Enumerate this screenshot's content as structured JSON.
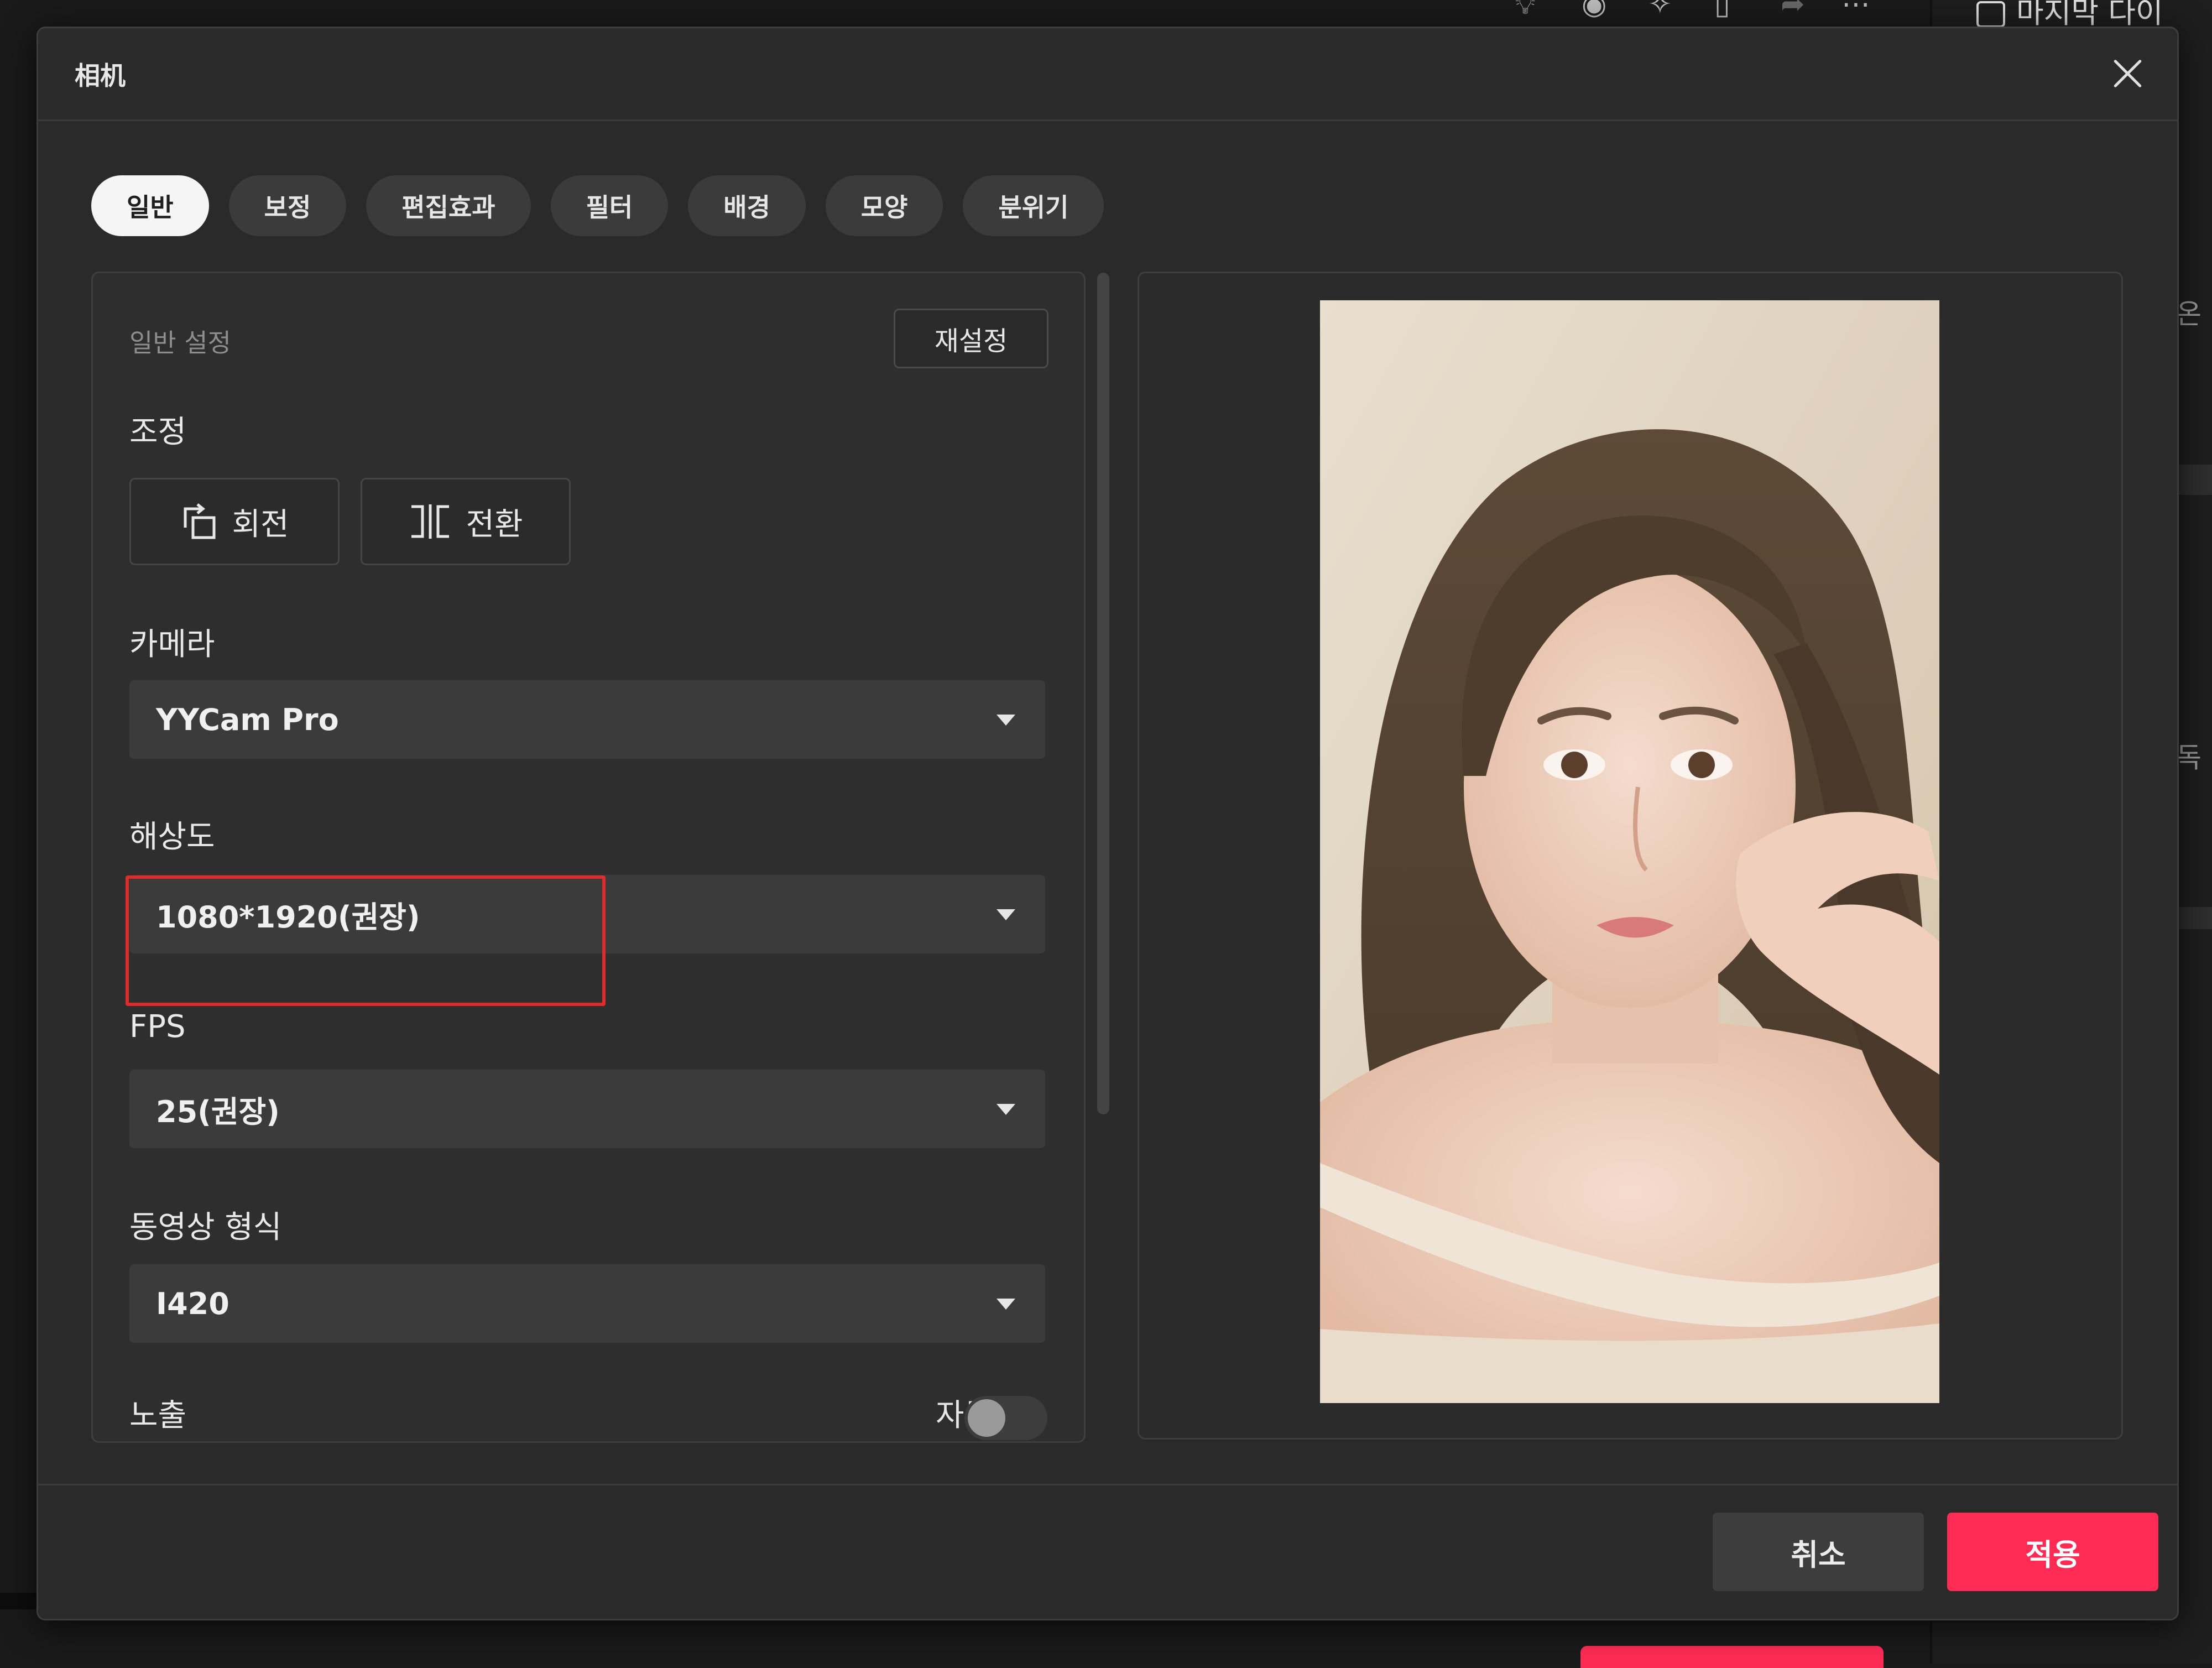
{
  "dialog": {
    "title": "相机",
    "tabs": [
      {
        "label": "일반",
        "active": true
      },
      {
        "label": "보정",
        "active": false
      },
      {
        "label": "편집효과",
        "active": false
      },
      {
        "label": "필터",
        "active": false
      },
      {
        "label": "배경",
        "active": false
      },
      {
        "label": "모양",
        "active": false
      },
      {
        "label": "분위기",
        "active": false
      }
    ],
    "settings": {
      "section_title": "일반 설정",
      "reset_label": "재설정",
      "adjust_label": "조정",
      "rotate_label": "회전",
      "flip_label": "전환",
      "camera_label": "카메라",
      "camera_value": "YYCam Pro",
      "resolution_label": "해상도",
      "resolution_value": "1080*1920(권장)",
      "fps_label": "FPS",
      "fps_value": "25(권장)",
      "video_format_label": "동영상 형식",
      "video_format_value": "I420",
      "exposure_label": "노출",
      "auto_label": "자동",
      "auto_enabled": false
    },
    "footer": {
      "cancel_label": "취소",
      "apply_label": "적용"
    }
  },
  "background": {
    "right_panel_title": "마지막 다이",
    "right_fragments": [
      "온",
      "독"
    ]
  },
  "colors": {
    "accent": "#fe2c55",
    "highlight": "#e12b2b",
    "dialog_bg": "#2a2a2a"
  }
}
